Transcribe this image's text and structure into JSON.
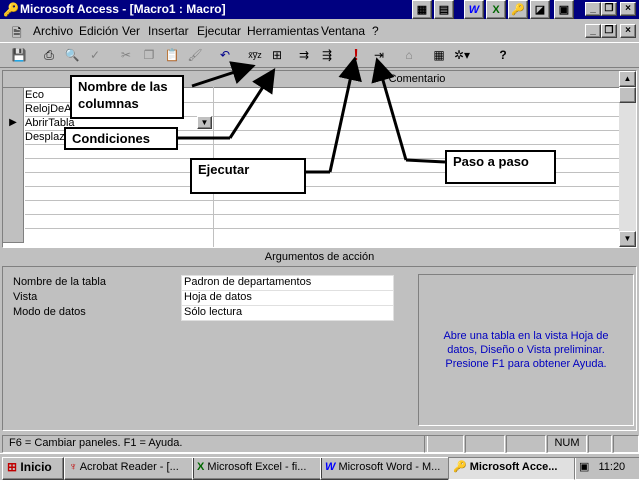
{
  "window": {
    "title": "Microsoft Access - [Macro1 : Macro]"
  },
  "menu": [
    "Archivo",
    "Edición",
    "Ver",
    "Insertar",
    "Ejecutar",
    "Herramientas",
    "Ventana",
    "?"
  ],
  "grid": {
    "columns": [
      "Comentario"
    ],
    "rows": [
      "Eco",
      "RelojDeArena",
      "AbrirTabla",
      "Desplazar"
    ]
  },
  "callouts": {
    "nombre_columnas": "Nombre de las columnas",
    "condiciones": "Condiciones",
    "ejecutar": "Ejecutar",
    "paso_a_paso": "Paso a paso"
  },
  "args": {
    "title": "Argumentos de acción",
    "items": [
      {
        "label": "Nombre de la tabla",
        "value": "Padron de departamentos"
      },
      {
        "label": "Vista",
        "value": "Hoja de datos"
      },
      {
        "label": "Modo de datos",
        "value": "Sólo lectura"
      }
    ],
    "help": "Abre una tabla en la vista Hoja de datos, Diseño o Vista preliminar. Presione F1 para obtener Ayuda."
  },
  "status": {
    "text": "F6 = Cambiar paneles.  F1 = Ayuda.",
    "num": "NUM"
  },
  "taskbar": {
    "start": "Inicio",
    "tasks": [
      "Acrobat Reader - [...",
      "Microsoft Excel - fi...",
      "Microsoft Word - M...",
      "Microsoft Acce..."
    ],
    "clock": "11:20"
  },
  "colors": {
    "titlebar": "#000080",
    "help_text": "#0000c0",
    "face": "#c0c0c0"
  }
}
